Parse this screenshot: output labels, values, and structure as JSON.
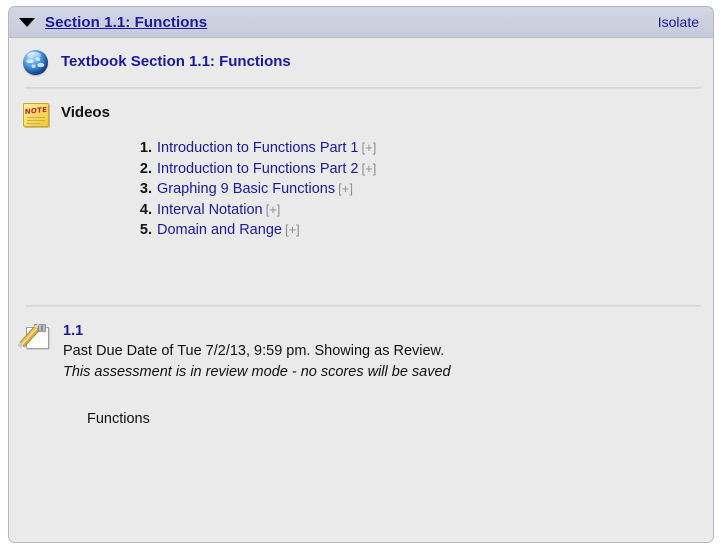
{
  "panel": {
    "header": {
      "title": "Section 1.1: Functions",
      "isolate_label": "Isolate",
      "disclosure_icon": "triangle-down-icon",
      "expanded": true
    },
    "sections": [
      {
        "icon": "globe-icon",
        "title": "Textbook Section 1.1: Functions"
      },
      {
        "icon": "sticky-note-icon",
        "icon_text": "NOTE",
        "title": "Videos",
        "videos": [
          {
            "number": "1.",
            "label": "Introduction to Functions Part 1",
            "expander": "[+]"
          },
          {
            "number": "2.",
            "label": "Introduction to Functions Part 2",
            "expander": "[+]"
          },
          {
            "number": "3.",
            "label": "Graphing 9 Basic Functions",
            "expander": "[+]"
          },
          {
            "number": "4.",
            "label": "Interval Notation",
            "expander": "[+]"
          },
          {
            "number": "5.",
            "label": "Domain and Range",
            "expander": "[+]"
          }
        ]
      }
    ],
    "assessment": {
      "icon": "notepad-pencil-icon",
      "link_label": "1.1",
      "due_text": "Past Due Date of Tue 7/2/13, 9:59 pm. Showing as Review.",
      "review_note": "This assessment is in review mode - no scores will be saved",
      "body_text": "Functions"
    }
  },
  "colors": {
    "link": "#1a1a9e",
    "header_bg": "#ccd0de",
    "body_bg": "#eaeaea",
    "expander": "#8f8f8f"
  }
}
